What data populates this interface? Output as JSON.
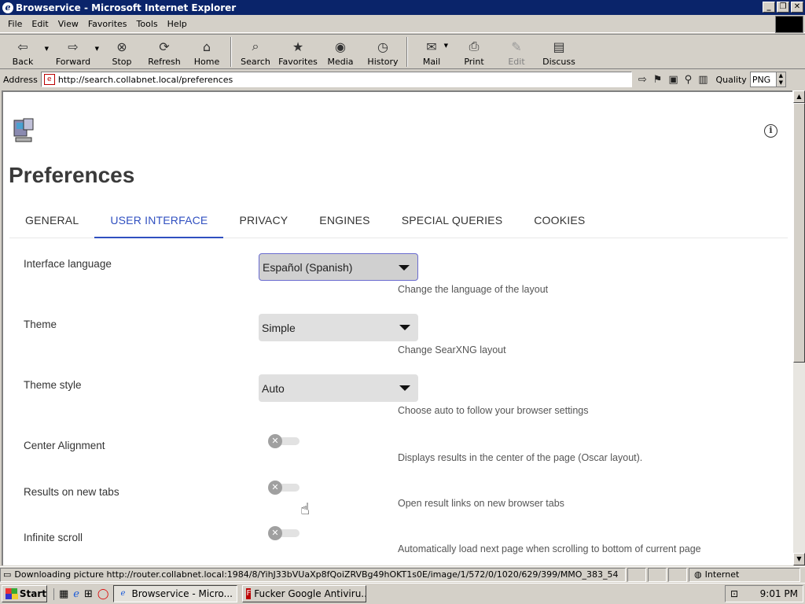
{
  "window": {
    "title": "Browservice - Microsoft Internet Explorer"
  },
  "menu": [
    "File",
    "Edit",
    "View",
    "Favorites",
    "Tools",
    "Help"
  ],
  "toolbar": {
    "back": "Back",
    "forward": "Forward",
    "stop": "Stop",
    "refresh": "Refresh",
    "home": "Home",
    "search": "Search",
    "favorites": "Favorites",
    "media": "Media",
    "history": "History",
    "mail": "Mail",
    "print": "Print",
    "edit": "Edit",
    "discuss": "Discuss"
  },
  "address": {
    "label": "Address",
    "url": "http://search.collabnet.local/preferences",
    "quality_label": "Quality",
    "quality_value": "PNG"
  },
  "page": {
    "title": "Preferences",
    "tabs": [
      "GENERAL",
      "USER INTERFACE",
      "PRIVACY",
      "ENGINES",
      "SPECIAL QUERIES",
      "COOKIES"
    ],
    "active_tab": "USER INTERFACE",
    "settings": {
      "language": {
        "label": "Interface language",
        "value": "Español (Spanish)",
        "help": "Change the language of the layout"
      },
      "theme": {
        "label": "Theme",
        "value": "Simple",
        "help": "Change SearXNG layout"
      },
      "theme_style": {
        "label": "Theme style",
        "value": "Auto",
        "help": "Choose auto to follow your browser settings"
      },
      "center": {
        "label": "Center Alignment",
        "help": "Displays results in the center of the page (Oscar layout).",
        "enabled": false
      },
      "new_tabs": {
        "label": "Results on new tabs",
        "help": "Open result links on new browser tabs",
        "enabled": false
      },
      "infinite": {
        "label": "Infinite scroll",
        "help": "Automatically load next page when scrolling to bottom of current page",
        "enabled": false
      }
    }
  },
  "status": {
    "text": "Downloading picture http://router.collabnet.local:1984/8/YihJ33bVUaXp8fQoiZRVBg49hOKT1s0E/image/1/572/0/1020/629/399/MMO_383_54",
    "zone": "Internet"
  },
  "taskbar": {
    "start": "Start",
    "tasks": [
      "Browservice - Micro...",
      "Fucker Google Antiviru..."
    ],
    "clock": "9:01 PM"
  },
  "colors": {
    "accent": "#3050c0",
    "titlebar": "#0a246a"
  }
}
